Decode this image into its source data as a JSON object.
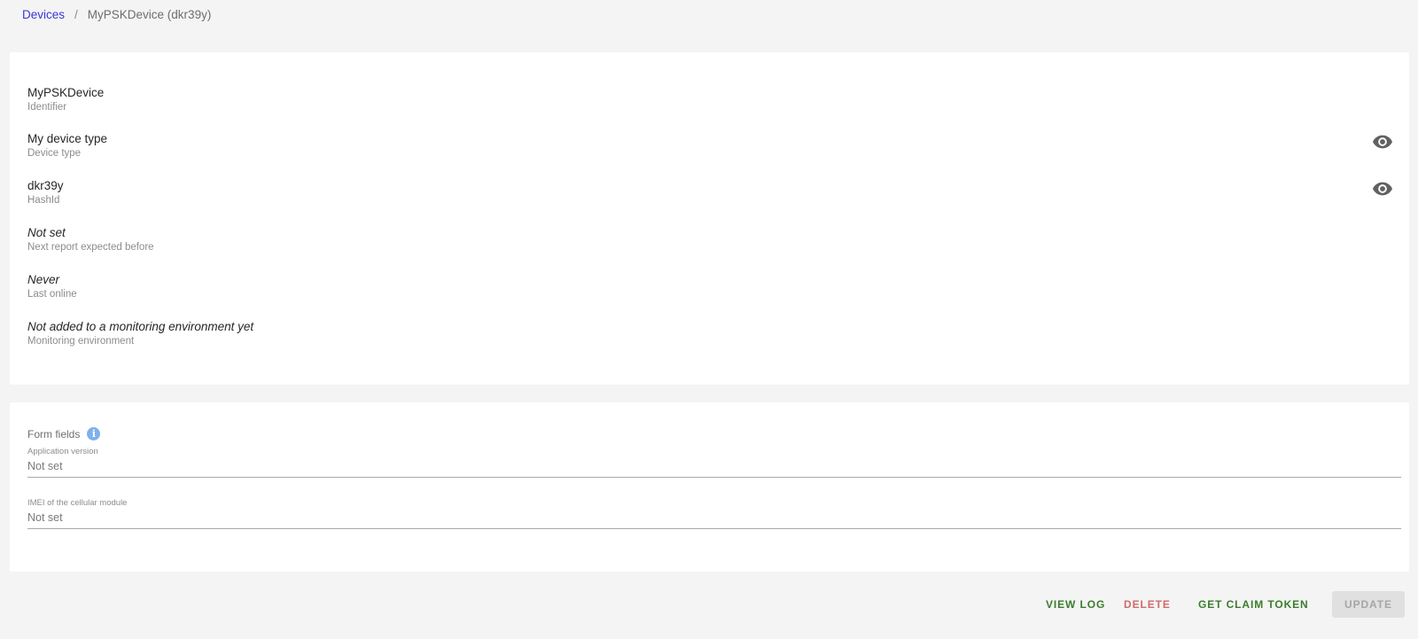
{
  "breadcrumb": {
    "root": "Devices",
    "separator": "/",
    "current": "MyPSKDevice (dkr39y)"
  },
  "info": {
    "items": [
      {
        "primary": "MyPSKDevice",
        "secondary": "Identifier"
      },
      {
        "primary": "My device type",
        "secondary": "Device type",
        "icon": "eye-icon"
      },
      {
        "primary": "dkr39y",
        "secondary": "HashId",
        "icon": "eye-icon"
      },
      {
        "primary": "Not set",
        "secondary": "Next report expected before"
      },
      {
        "primary": "Never",
        "secondary": "Last online"
      },
      {
        "primary": "Not added to a monitoring environment yet",
        "secondary": "Monitoring environment"
      }
    ]
  },
  "form": {
    "heading": "Form fields",
    "info_icon": "i",
    "fields": [
      {
        "label": "Application version",
        "value": "Not set"
      },
      {
        "label": "IMEI of the cellular module",
        "value": "Not set"
      }
    ]
  },
  "actions": {
    "view_log": "VIEW LOG",
    "delete": "DELETE",
    "get_claim_token": "GET CLAIM TOKEN",
    "update": "UPDATE"
  },
  "colors": {
    "link": "#3b36d6",
    "action_green": "#3a7d2c",
    "action_red": "#d06b6b",
    "info_icon": "#7fb1ec",
    "background": "#f4f4f4"
  }
}
